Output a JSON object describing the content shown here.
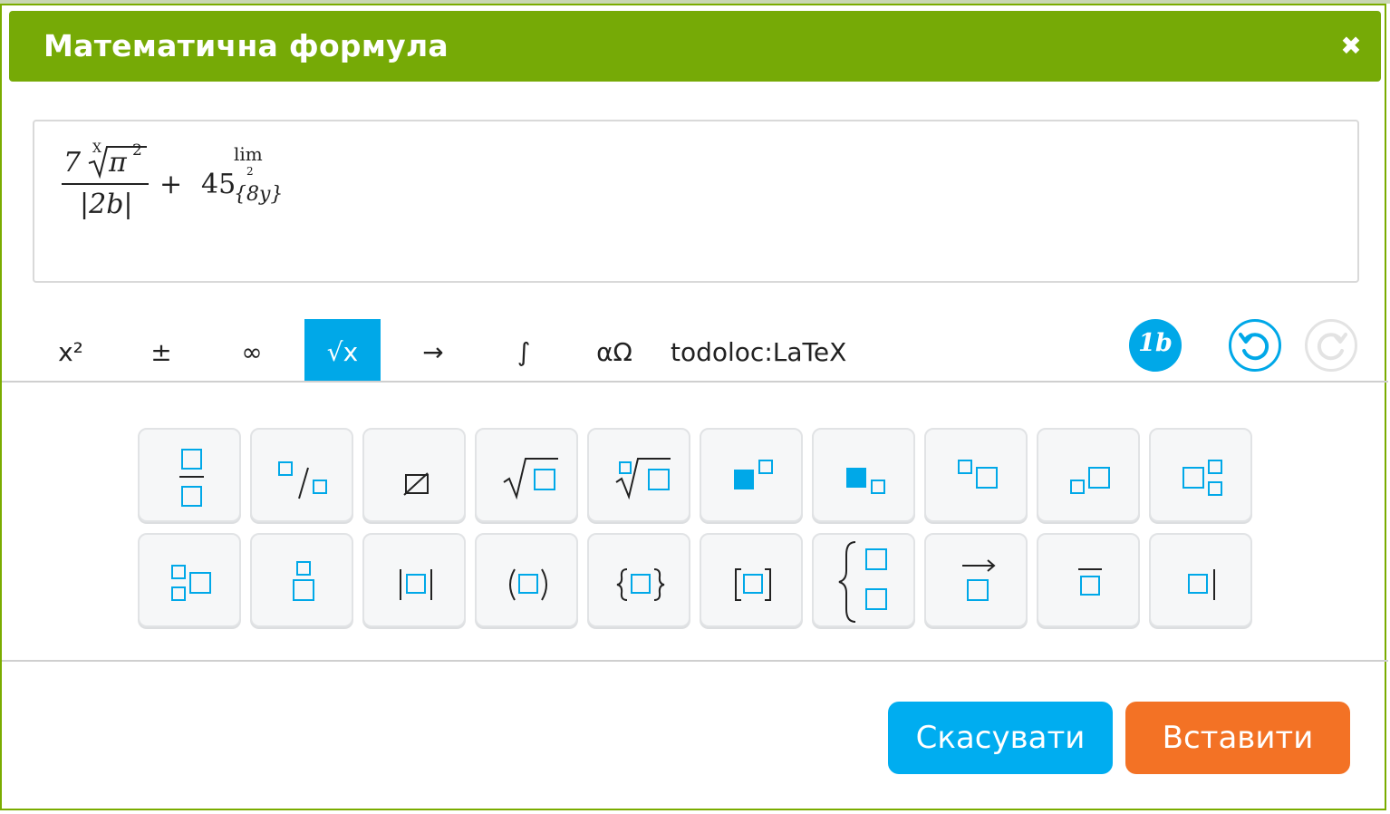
{
  "dialog": {
    "title": "Математична формула",
    "close_label": "✖"
  },
  "formula": {
    "numerator_coef": "7",
    "root_index": "X",
    "root_radicand": "π",
    "root_exponent": "2",
    "denominator": "|2b|",
    "plus": "+",
    "base": "45",
    "sup_lim": "lim",
    "sup_lim_sub": "2",
    "subscript": "{8y}"
  },
  "tabs": [
    {
      "label": "x²"
    },
    {
      "label": "±"
    },
    {
      "label": "∞"
    },
    {
      "label": "√x"
    },
    {
      "label": "→"
    },
    {
      "label": "∫"
    },
    {
      "label": "αΩ"
    },
    {
      "label": "todoloc:LaTeX"
    }
  ],
  "toolbar": {
    "style_button": "1b",
    "undo_icon": "undo-icon",
    "redo_icon": "redo-icon"
  },
  "footer": {
    "cancel_label": "Скасувати",
    "insert_label": "Вставити"
  },
  "colors": {
    "header": "#76aa06",
    "accent": "#00a8e8",
    "insert": "#f37225",
    "placeholder": "#00a8e8"
  }
}
